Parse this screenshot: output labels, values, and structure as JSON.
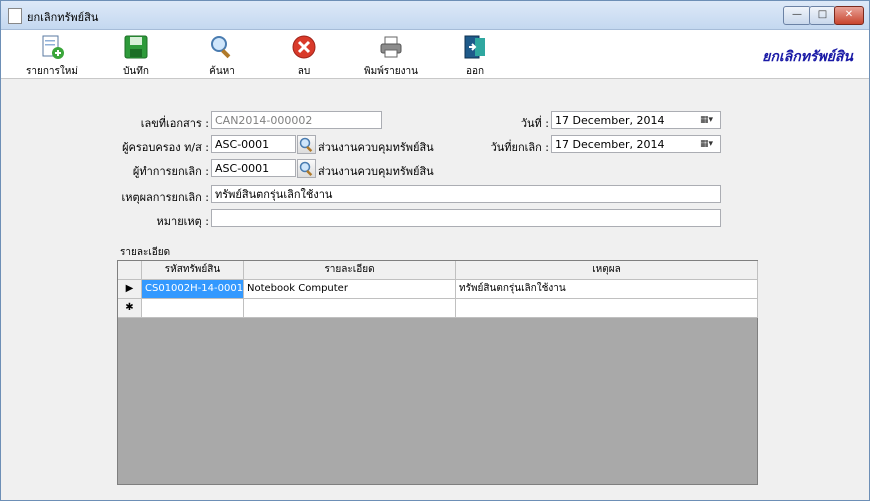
{
  "window": {
    "title": "ยกเลิกทรัพย์สิน",
    "min": "—",
    "max": "□",
    "close": "✕"
  },
  "toolbar": {
    "new": "รายการใหม่",
    "save": "บันทึก",
    "search": "ค้นหา",
    "delete": "ลบ",
    "print": "พิมพ์รายงาน",
    "exit": "ออก",
    "brand": "ยกเลิกทรัพย์สิน"
  },
  "form": {
    "doc_no_label": "เลขที่เอกสาร :",
    "doc_no_value": "CAN2014-000002",
    "date_label": "วันที่ :",
    "date_value": "17 December, 2014",
    "custodian_label": "ผู้ครอบครอง ท/ส :",
    "custodian_value": "ASC-0001",
    "custodian_dept": "ส่วนงานควบคุมทรัพย์สิน",
    "cancel_date_label": "วันที่ยกเลิก :",
    "cancel_date_value": "17 December, 2014",
    "canceller_label": "ผู้ทำการยกเลิก :",
    "canceller_value": "ASC-0001",
    "canceller_dept": "ส่วนงานควบคุมทรัพย์สิน",
    "reason_label": "เหตุผลการยกเลิก :",
    "reason_value": "ทรัพย์สินตกรุ่นเลิกใช้งาน",
    "note_label": "หมายเหตุ :",
    "note_value": ""
  },
  "details": {
    "group_title": "รายละเอียด",
    "columns": [
      "รหัสทรัพย์สิน",
      "รายละเอียด",
      "เหตุผล"
    ],
    "rows": [
      {
        "marker": "▶",
        "code": "CS01002H-14-0001",
        "desc": "Notebook Computer",
        "reason": "ทรัพย์สินตกรุ่นเลิกใช้งาน"
      },
      {
        "marker": "✱",
        "code": "",
        "desc": "",
        "reason": ""
      }
    ]
  },
  "colors": {
    "brand": "#1a1aa6",
    "selection": "#3399ff",
    "grid_empty": "#a9a9a9"
  }
}
